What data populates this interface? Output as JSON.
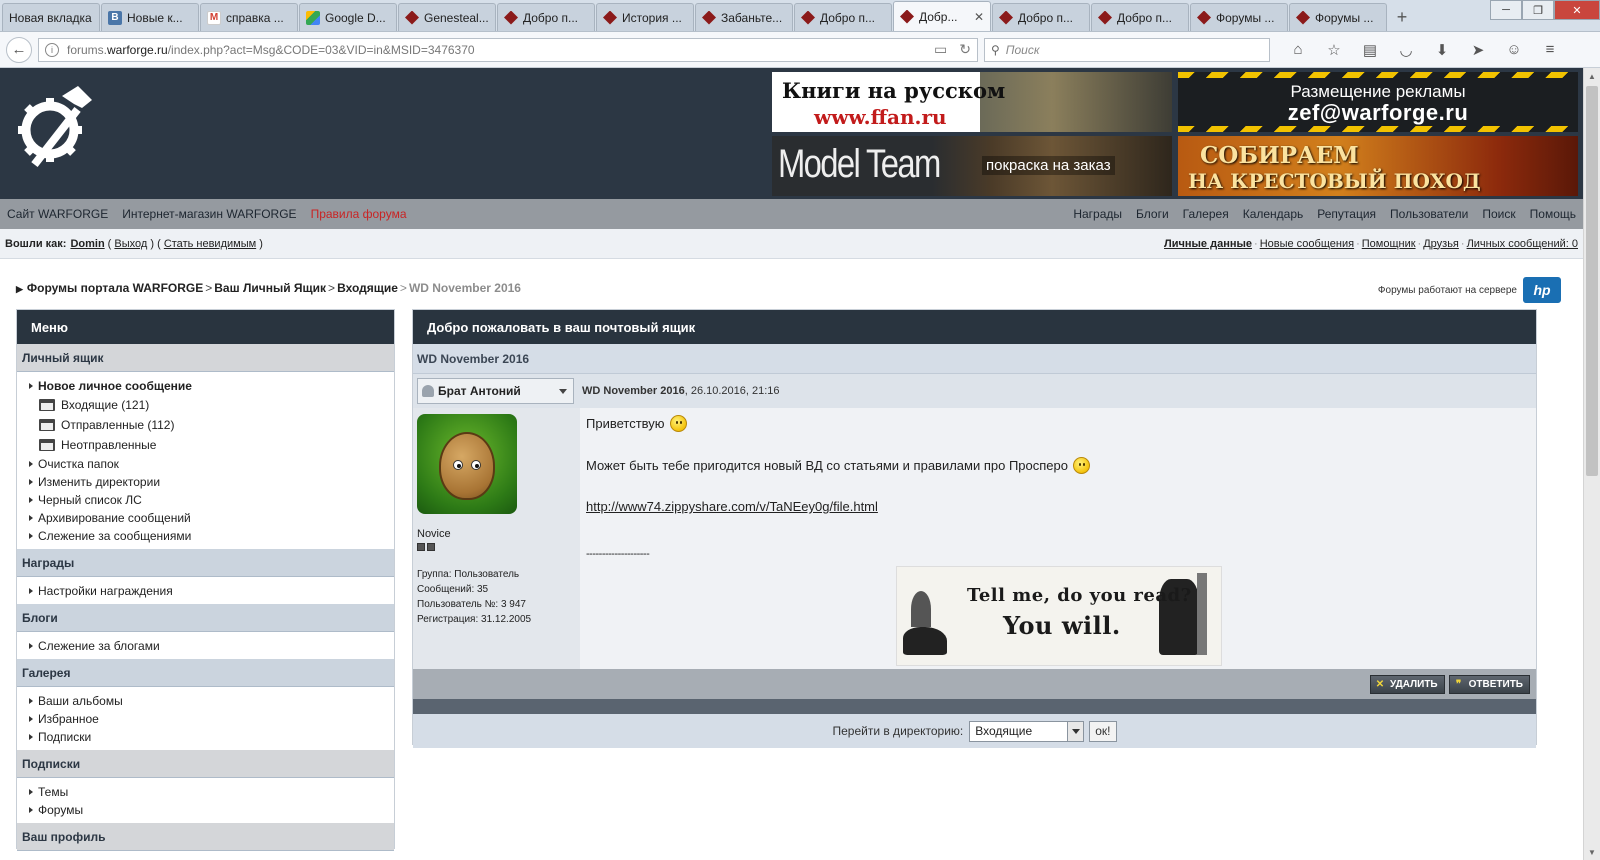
{
  "browser": {
    "tabs": [
      {
        "label": "Новая вкладка",
        "icon": "none",
        "active": false
      },
      {
        "label": "Новые к...",
        "icon": "vk",
        "active": false
      },
      {
        "label": "справка ...",
        "icon": "gmail",
        "active": false
      },
      {
        "label": "Google D...",
        "icon": "gdrive",
        "active": false
      },
      {
        "label": "Genesteal...",
        "icon": "warforge",
        "active": false
      },
      {
        "label": "Добро п...",
        "icon": "warforge",
        "active": false
      },
      {
        "label": "История ...",
        "icon": "warforge",
        "active": false
      },
      {
        "label": "Забаньте...",
        "icon": "warforge",
        "active": false
      },
      {
        "label": "Добро п...",
        "icon": "warforge",
        "active": false
      },
      {
        "label": "Добр...",
        "icon": "warforge",
        "active": true
      },
      {
        "label": "Добро п...",
        "icon": "warforge",
        "active": false
      },
      {
        "label": "Добро п...",
        "icon": "warforge",
        "active": false
      },
      {
        "label": "Форумы ...",
        "icon": "warforge",
        "active": false
      },
      {
        "label": "Форумы ...",
        "icon": "warforge",
        "active": false
      }
    ],
    "url_prefix": "forums.",
    "url_domain": "warforge.ru",
    "url_path": "/index.php?act=Msg&CODE=03&VID=in&MSID=3476370",
    "search_placeholder": "Поиск",
    "tab_close_glyph": "✕",
    "new_tab_glyph": "+"
  },
  "header": {
    "banners": [
      {
        "line1": "Книги на русском",
        "line2": "www.ffan.ru"
      },
      {
        "line1": "Размещение рекламы",
        "line2": "zef@warforge.ru"
      },
      {
        "line1": "Model Team",
        "line2": "покраска на заказ"
      },
      {
        "line1": "СОБИРАЕМ",
        "line2": "НА КРЕСТОВЫЙ ПОХОД"
      }
    ]
  },
  "topnav": {
    "left": [
      "Сайт WARFORGE",
      "Интернет-магазин WARFORGE",
      "Правила форума"
    ],
    "right": [
      "Награды",
      "Блоги",
      "Галерея",
      "Календарь",
      "Репутация",
      "Пользователи",
      "Поиск",
      "Помощь"
    ]
  },
  "userbar": {
    "logged_as": "Вошли как:",
    "username": "Domin",
    "logout": "Выход",
    "invisible": "Стать невидимым",
    "links": [
      "Личные данные",
      "Новые сообщения",
      "Помощник",
      "Друзья",
      "Личных сообщений: 0"
    ]
  },
  "breadcrumb": {
    "items": [
      "Форумы портала WARFORGE",
      "Ваш Личный Ящик",
      "Входящие"
    ],
    "current": "WD November 2016",
    "server_text": "Форумы работают на сервере",
    "server_logo": "hp"
  },
  "menu": {
    "title": "Меню",
    "sections": [
      {
        "title": "Личный ящик",
        "style": "grey",
        "items": [
          {
            "label": "Новое личное сообщение",
            "kind": "bold"
          },
          {
            "label": "Входящие (121)",
            "kind": "folder"
          },
          {
            "label": "Отправленные (112)",
            "kind": "folder"
          },
          {
            "label": "Неотправленные",
            "kind": "folder"
          },
          {
            "label": "Очистка папок",
            "kind": "item"
          },
          {
            "label": "Изменить директории",
            "kind": "item"
          },
          {
            "label": "Черный список ЛС",
            "kind": "item"
          },
          {
            "label": "Архивирование сообщений",
            "kind": "item"
          },
          {
            "label": "Слежение за сообщениями",
            "kind": "item"
          }
        ]
      },
      {
        "title": "Награды",
        "style": "blue",
        "items": [
          {
            "label": "Настройки награждения",
            "kind": "item"
          }
        ]
      },
      {
        "title": "Блоги",
        "style": "blue",
        "items": [
          {
            "label": "Слежение за блогами",
            "kind": "item"
          }
        ]
      },
      {
        "title": "Галерея",
        "style": "blue",
        "items": [
          {
            "label": "Ваши альбомы",
            "kind": "item"
          },
          {
            "label": "Избранное",
            "kind": "item"
          },
          {
            "label": "Подписки",
            "kind": "item"
          }
        ]
      },
      {
        "title": "Подписки",
        "style": "grey",
        "items": [
          {
            "label": "Темы",
            "kind": "item"
          },
          {
            "label": "Форумы",
            "kind": "item"
          }
        ]
      },
      {
        "title": "Ваш профиль",
        "style": "grey",
        "items": []
      }
    ]
  },
  "main": {
    "title": "Добро пожаловать в ваш почтовый ящик",
    "subject": "WD November 2016",
    "post": {
      "author": "Брат Антоний",
      "subject_bold": "WD November 2016",
      "date": ", 26.10.2016, 21:16",
      "rank": "Novice",
      "stats": [
        "Группа: Пользователь",
        "Сообщений: 35",
        "Пользователь №: 3 947",
        "Регистрация: 31.12.2005"
      ],
      "greeting": "Приветствую",
      "message": "Может быть тебе пригодится новый ВД со статьями и правилами про Просперо",
      "link": "http://www74.zippyshare.com/v/TaNEey0g/file.html",
      "signature_line": "--------------------",
      "signature_text1": "Tell me, do you read?",
      "signature_text2": "You will."
    },
    "actions": [
      {
        "label": "УДАЛИТЬ",
        "icon": "✕"
      },
      {
        "label": "ОТВЕТИТЬ",
        "icon": "❞"
      }
    ],
    "jump_label": "Перейти в директорию:",
    "jump_value": "Входящие",
    "ok_label": "ок!"
  }
}
